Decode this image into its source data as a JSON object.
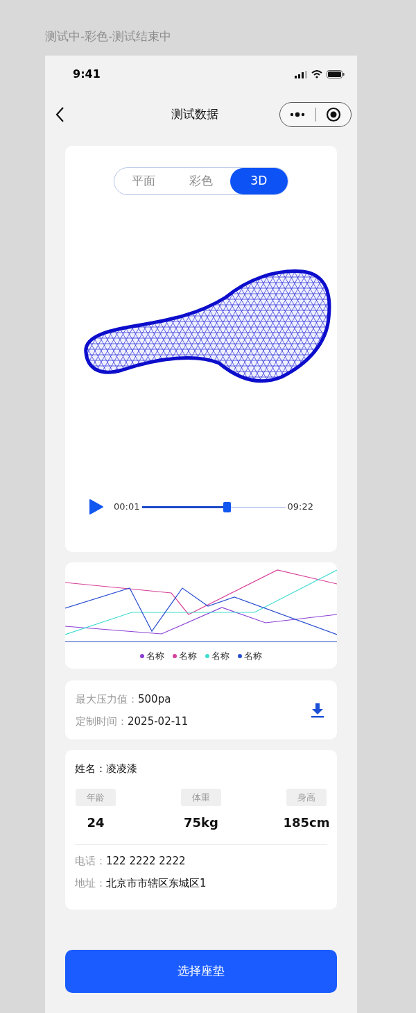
{
  "caption": "测试中-彩色-测试结束中",
  "status_bar": {
    "time": "9:41"
  },
  "nav": {
    "title": "测试数据"
  },
  "view_tabs": [
    {
      "label": "平面",
      "selected": false
    },
    {
      "label": "彩色",
      "selected": false
    },
    {
      "label": "3D",
      "selected": true
    }
  ],
  "player": {
    "current": "00:01",
    "total": "09:22",
    "level": 0.59
  },
  "legend": [
    {
      "label": "名称",
      "color": "#8a3fd6"
    },
    {
      "label": "名称",
      "color": "#d6409a"
    },
    {
      "label": "名称",
      "color": "#40dcd0"
    },
    {
      "label": "名称",
      "color": "#2a4fd0"
    }
  ],
  "stats": [
    {
      "label": "最大压力值：",
      "value": "500pa"
    },
    {
      "label": "定制时间：",
      "value": "2025-02-11"
    }
  ],
  "person": {
    "name_label": "姓名：",
    "name": "凌凌漆",
    "metrics": [
      {
        "label": "年龄",
        "value": "24"
      },
      {
        "label": "体重",
        "value": "75kg"
      },
      {
        "label": "身高",
        "value": "185cm"
      }
    ],
    "contacts": [
      {
        "label": "电话：",
        "value": "122 2222 2222"
      },
      {
        "label": "地址：",
        "value": "北京市市辖区东城区1"
      }
    ]
  },
  "button": "选择座垫"
}
